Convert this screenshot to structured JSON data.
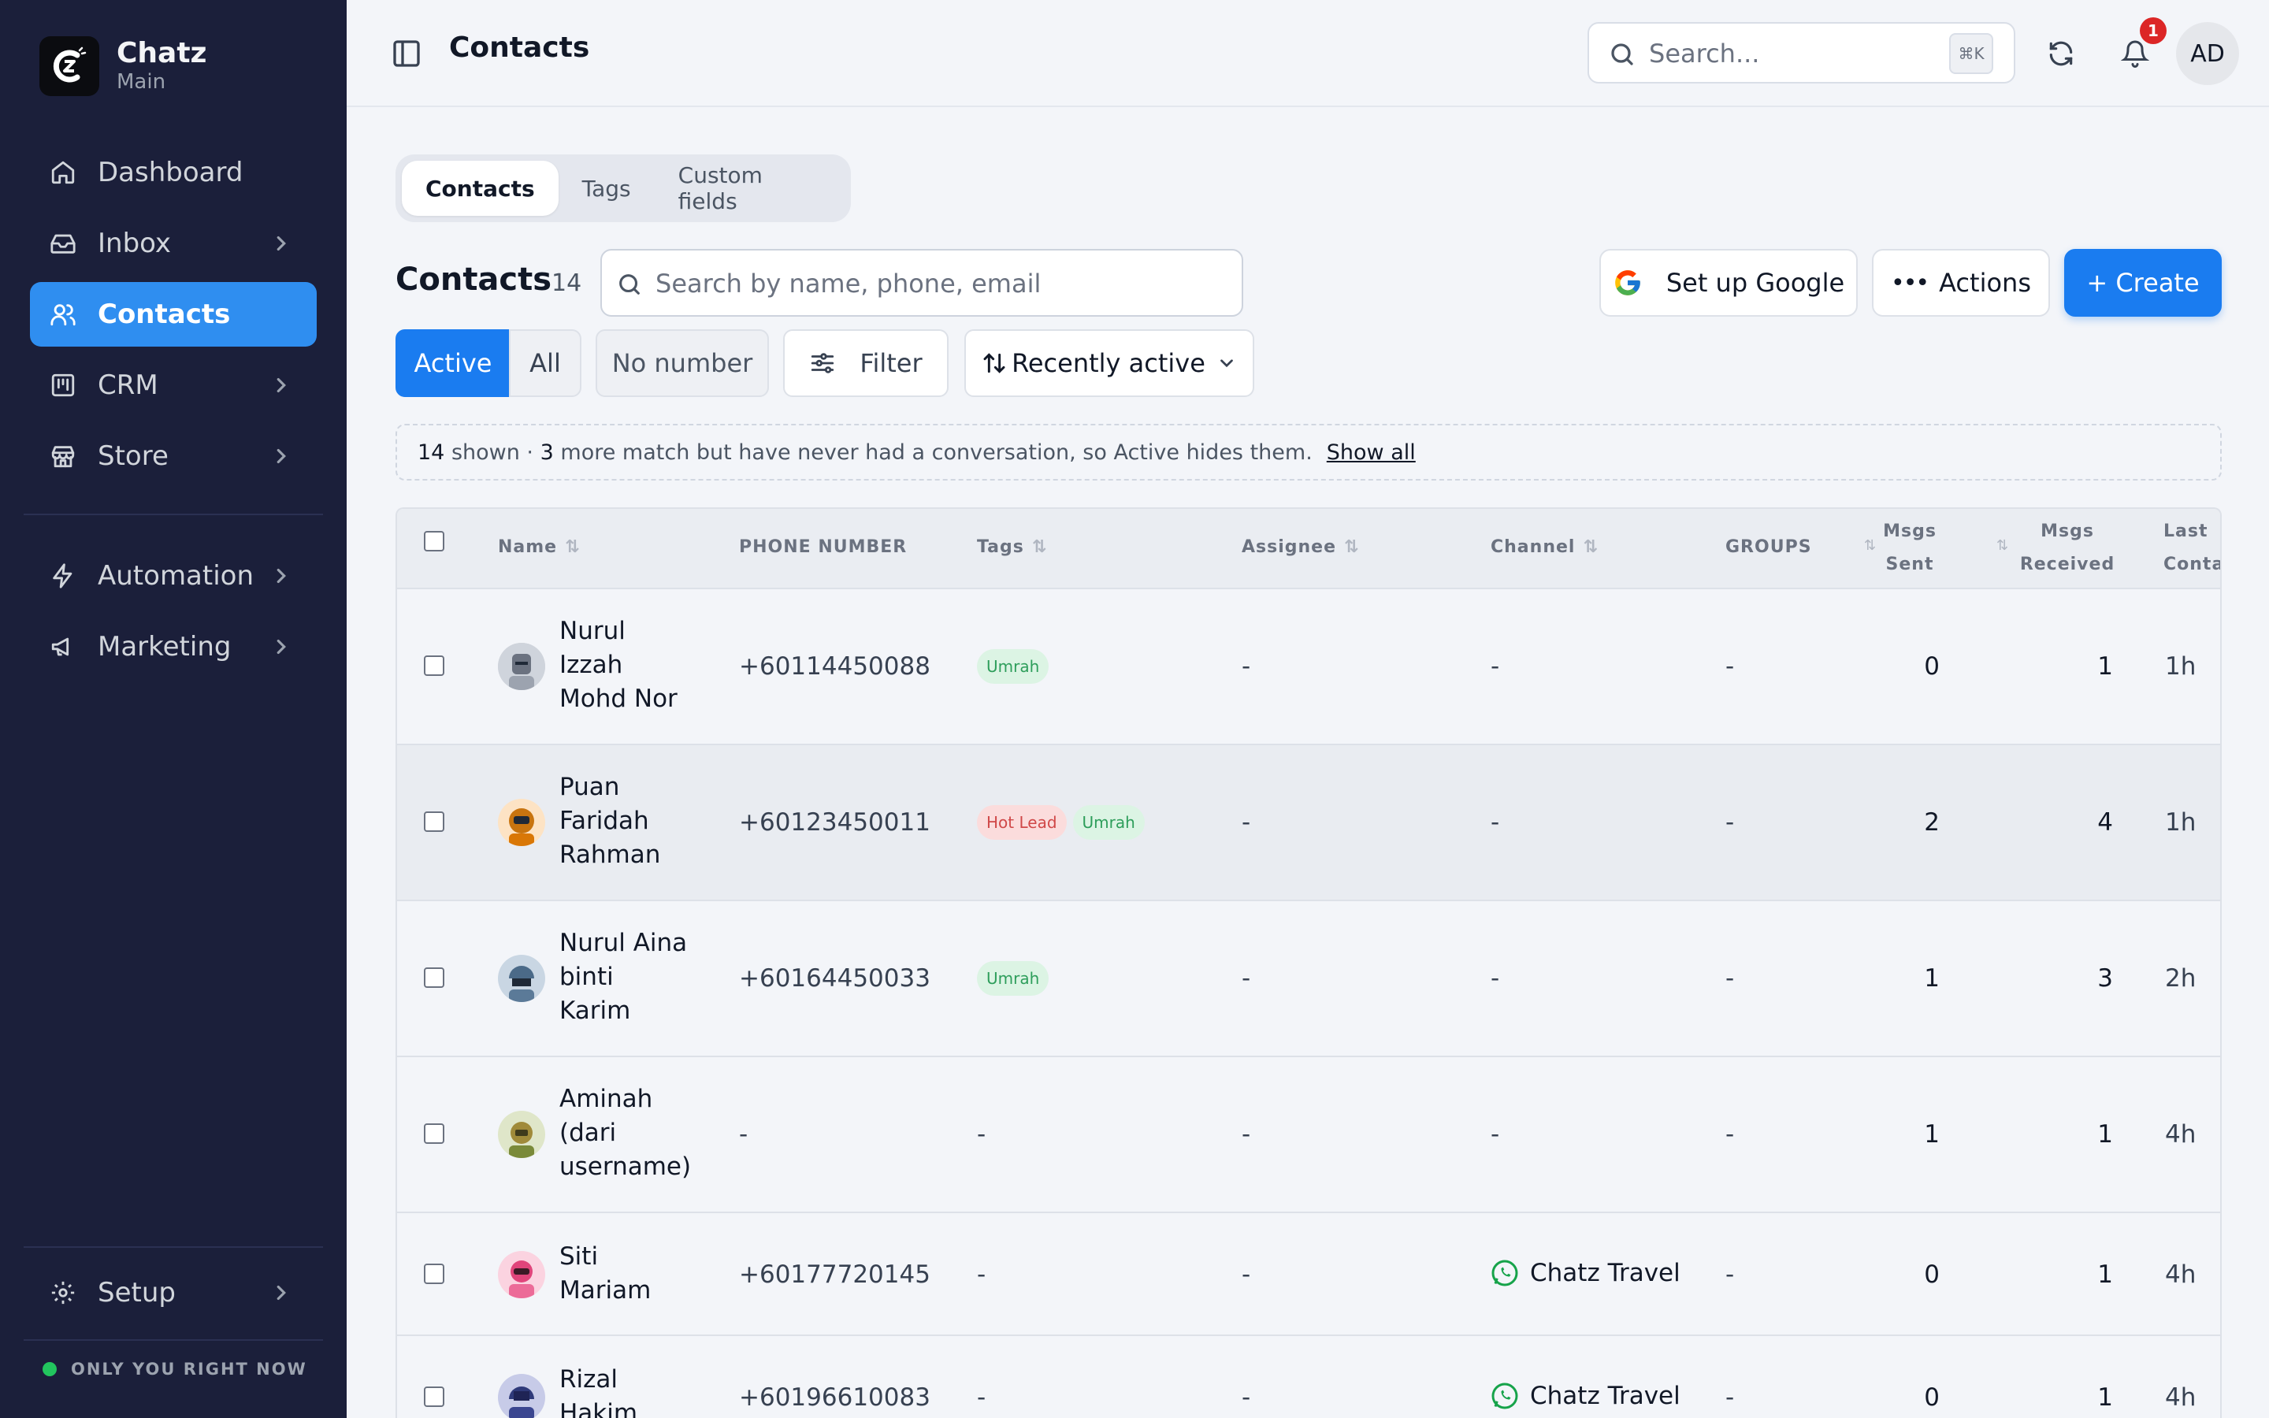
{
  "app": {
    "name": "Chatz",
    "workspace": "Main"
  },
  "sidebar": {
    "items": [
      {
        "label": "Dashboard",
        "icon": "home-icon"
      },
      {
        "label": "Inbox",
        "icon": "inbox-icon"
      },
      {
        "label": "Contacts",
        "icon": "users-icon"
      },
      {
        "label": "CRM",
        "icon": "kanban-icon"
      },
      {
        "label": "Store",
        "icon": "store-icon"
      },
      {
        "label": "Automation",
        "icon": "bolt-icon"
      },
      {
        "label": "Marketing",
        "icon": "megaphone-icon"
      }
    ],
    "setup_label": "Setup",
    "presence": "ONLY YOU RIGHT NOW"
  },
  "topbar": {
    "title": "Contacts",
    "search_placeholder": "Search...",
    "shortcut": "⌘K",
    "notification_count": "1",
    "user_initials": "AD"
  },
  "tabs": [
    "Contacts",
    "Tags",
    "Custom fields"
  ],
  "contacts": {
    "title": "Contacts",
    "count": "14",
    "search_placeholder": "Search by name, phone, email",
    "google_button": "Set up Google",
    "actions_button": "Actions",
    "create_button": "+ Create",
    "filters": {
      "active": "Active",
      "all": "All",
      "no_number": "No number",
      "filter": "Filter",
      "sort": "Recently active"
    },
    "banner": {
      "shown": "14",
      "shown_suffix": "shown ·",
      "more": "3",
      "more_suffix": "more match but have never had a conversation, so Active hides them.",
      "show_all": "Show all"
    }
  },
  "table": {
    "headers": {
      "name": "Name",
      "phone": "PHONE NUMBER",
      "tags": "Tags",
      "assignee": "Assignee",
      "channel": "Channel",
      "groups": "GROUPS",
      "sent_1": "Msgs",
      "sent_2": "Sent",
      "recv_1": "Msgs",
      "recv_2": "Received",
      "last_1": "Last",
      "last_2": "Contact"
    },
    "rows": [
      {
        "name": "Nurul Izzah Mohd Nor",
        "n1": "Nurul",
        "n2": "Izzah",
        "n3": "Mohd Nor",
        "phone": "+60114450088",
        "tag1": "Umrah",
        "tag2": "",
        "assignee": "-",
        "channel": "-",
        "groups": "-",
        "sent": "0",
        "received": "1",
        "last": "1h"
      },
      {
        "name": "Puan Faridah Rahman",
        "n1": "Puan",
        "n2": "Faridah",
        "n3": "Rahman",
        "phone": "+60123450011",
        "tag1": "Hot Lead",
        "tag2": "Umrah",
        "assignee": "-",
        "channel": "-",
        "groups": "-",
        "sent": "2",
        "received": "4",
        "last": "1h"
      },
      {
        "name": "Nurul Aina binti Karim",
        "n1": "Nurul Aina",
        "n2": "binti",
        "n3": "Karim",
        "phone": "+60164450033",
        "tag1": "Umrah",
        "tag2": "",
        "assignee": "-",
        "channel": "-",
        "groups": "-",
        "sent": "1",
        "received": "3",
        "last": "2h"
      },
      {
        "name": "Aminah (dari username)",
        "n1": "Aminah",
        "n2": "(dari",
        "n3": "username)",
        "phone": "-",
        "tag1": "-",
        "tag2": "",
        "assignee": "-",
        "channel": "-",
        "groups": "-",
        "sent": "1",
        "received": "1",
        "last": "4h"
      },
      {
        "name": "Siti Mariam",
        "n1": "Siti",
        "n2": "Mariam",
        "n3": "",
        "phone": "+60177720145",
        "tag1": "-",
        "tag2": "",
        "assignee": "-",
        "channel": "Chatz Travel",
        "groups": "-",
        "sent": "0",
        "received": "1",
        "last": "4h"
      },
      {
        "name": "Rizal Hakim",
        "n1": "Rizal",
        "n2": "Hakim",
        "n3": "",
        "phone": "+60196610083",
        "tag1": "-",
        "tag2": "",
        "assignee": "-",
        "channel": "Chatz Travel",
        "groups": "-",
        "sent": "0",
        "received": "1",
        "last": "4h"
      }
    ]
  },
  "colors": {
    "sidebar_bg": "#1b1f3a",
    "accent": "#2f8ef0",
    "primary": "#1a7cf0",
    "badge": "#dc2626",
    "whatsapp": "#25d366"
  }
}
